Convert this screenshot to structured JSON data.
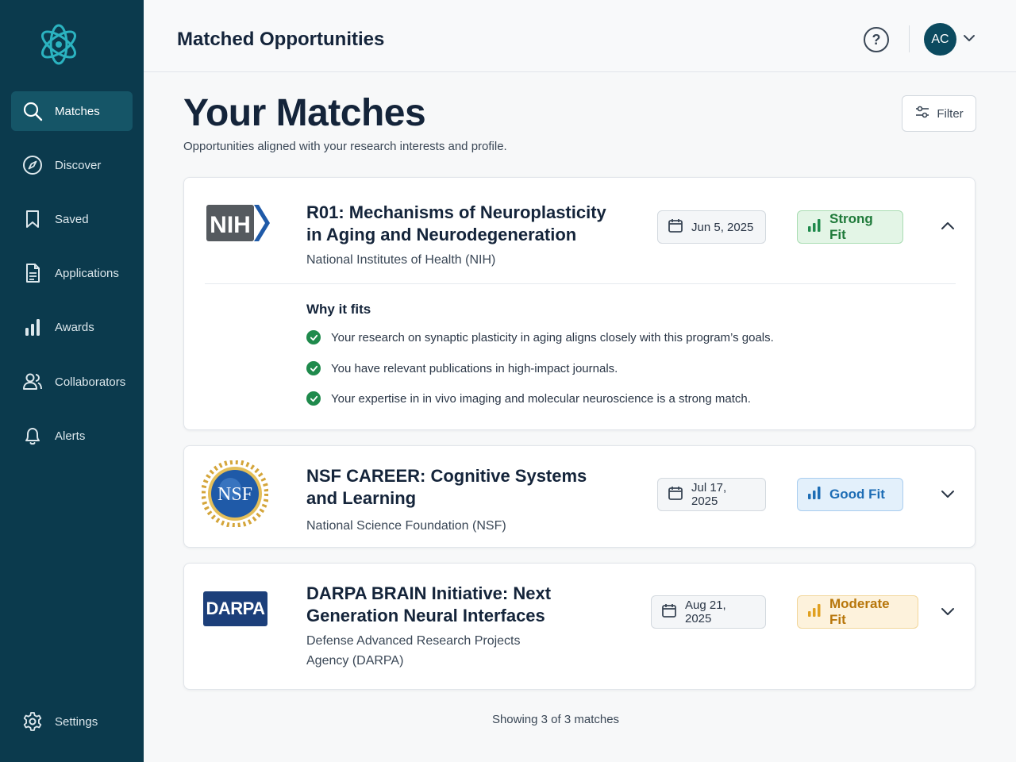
{
  "sidebar": {
    "logo_icon": "atom-icon",
    "items": [
      {
        "label": "Matches",
        "icon": "search-icon",
        "active": true
      },
      {
        "label": "Discover",
        "icon": "compass-icon",
        "active": false
      },
      {
        "label": "Saved",
        "icon": "bookmark-icon",
        "active": false
      },
      {
        "label": "Applications",
        "icon": "document-icon",
        "active": false
      },
      {
        "label": "Awards",
        "icon": "bar-chart-icon",
        "active": false
      },
      {
        "label": "Collaborators",
        "icon": "users-icon",
        "active": false
      },
      {
        "label": "Alerts",
        "icon": "bell-icon",
        "active": false
      }
    ],
    "settings": {
      "label": "Settings",
      "icon": "gear-icon"
    }
  },
  "header": {
    "title": "Matched Opportunities",
    "help_icon": "help-icon",
    "avatar_initials": "AC"
  },
  "main": {
    "title": "Your Matches",
    "subtitle": "Opportunities aligned with your research interests and profile.",
    "filter_label": "Filter"
  },
  "matches": [
    {
      "logo_text": "NIH",
      "title": "R01: Mechanisms of Neuroplasticity in Aging and Neurodegeneration",
      "agency": "National Institutes of Health (NIH)",
      "date": "Jun 5, 2025",
      "fit": "Strong Fit",
      "expanded": true,
      "why_title": "Why it fits",
      "reasons": [
        "Your research on synaptic plasticity in aging aligns closely with this program’s goals.",
        "You have relevant publications in high-impact journals.",
        "Your expertise in in vivo imaging and molecular neuroscience is a strong match."
      ]
    },
    {
      "logo_text": "NSF",
      "title": "NSF CAREER: Cognitive Systems and Learning",
      "agency": "National Science Foundation (NSF)",
      "date": "Jul 17, 2025",
      "fit": "Good Fit",
      "expanded": false
    },
    {
      "logo_text": "DARPA",
      "title": "DARPA BRAIN Initiative: Next Generation Neural Interfaces",
      "agency": "Defense Advanced Research Projects Agency (DARPA)",
      "date": "Aug 21, 2025",
      "fit": "Moderate Fit",
      "expanded": false
    }
  ],
  "footer": {
    "count_text": "Showing 3 of 3 matches"
  },
  "colors": {
    "sidebar_bg": "#0b3a4d",
    "sidebar_active": "#155567",
    "strong_fit": "#1f7a3a",
    "good_fit": "#1d6db5",
    "moderate_fit": "#b7760b",
    "accent_teal": "#2bb3c0"
  }
}
